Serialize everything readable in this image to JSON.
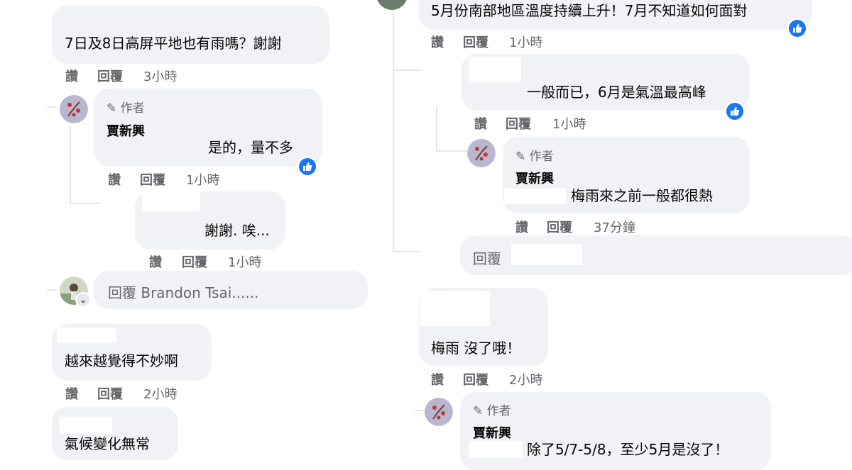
{
  "left": {
    "c1": {
      "text": "7日及8日高屏平地也有雨嗎？謝謝",
      "like": "讚",
      "reply": "回覆",
      "time": "3小時"
    },
    "c1r1": {
      "author_tag": "作者",
      "name": "賈新興",
      "text": "是的，量不多",
      "like": "讚",
      "reply": "回覆",
      "time": "1小時"
    },
    "c1r2": {
      "text": "謝謝. 唉...",
      "like": "讚",
      "reply": "回覆",
      "time": "1小時"
    },
    "reply_input": {
      "placeholder": "回覆 Brandon Tsai......"
    },
    "c2": {
      "text": "越來越覺得不妙啊",
      "like": "讚",
      "reply": "回覆",
      "time": "2小時"
    },
    "c3": {
      "text": "氣候變化無常"
    }
  },
  "right": {
    "c1": {
      "text": "5月份南部地區溫度持續上升！7月不知道如何面對",
      "like": "讚",
      "reply": "回覆",
      "time": "1小時"
    },
    "c1r1": {
      "text": "一般而已，6月是氣溫最高峰",
      "like": "讚",
      "reply": "回覆",
      "time": "1小時"
    },
    "c1r2": {
      "author_tag": "作者",
      "name": "賈新興",
      "text": "梅雨來之前一般都很熱",
      "like": "讚",
      "reply": "回覆",
      "time": "37分鐘"
    },
    "reply_input": {
      "placeholder": "回覆"
    },
    "c2": {
      "text": "梅雨 沒了哦！",
      "like": "讚",
      "reply": "回覆",
      "time": "2小時"
    },
    "c2r1": {
      "author_tag": "作者",
      "name": "賈新興",
      "text": "除了5/7-5/8，至少5月是沒了！"
    }
  },
  "colors": {
    "bubble": "#f0f2f5",
    "like_blue": "#1877f2",
    "meta": "#65676b"
  }
}
